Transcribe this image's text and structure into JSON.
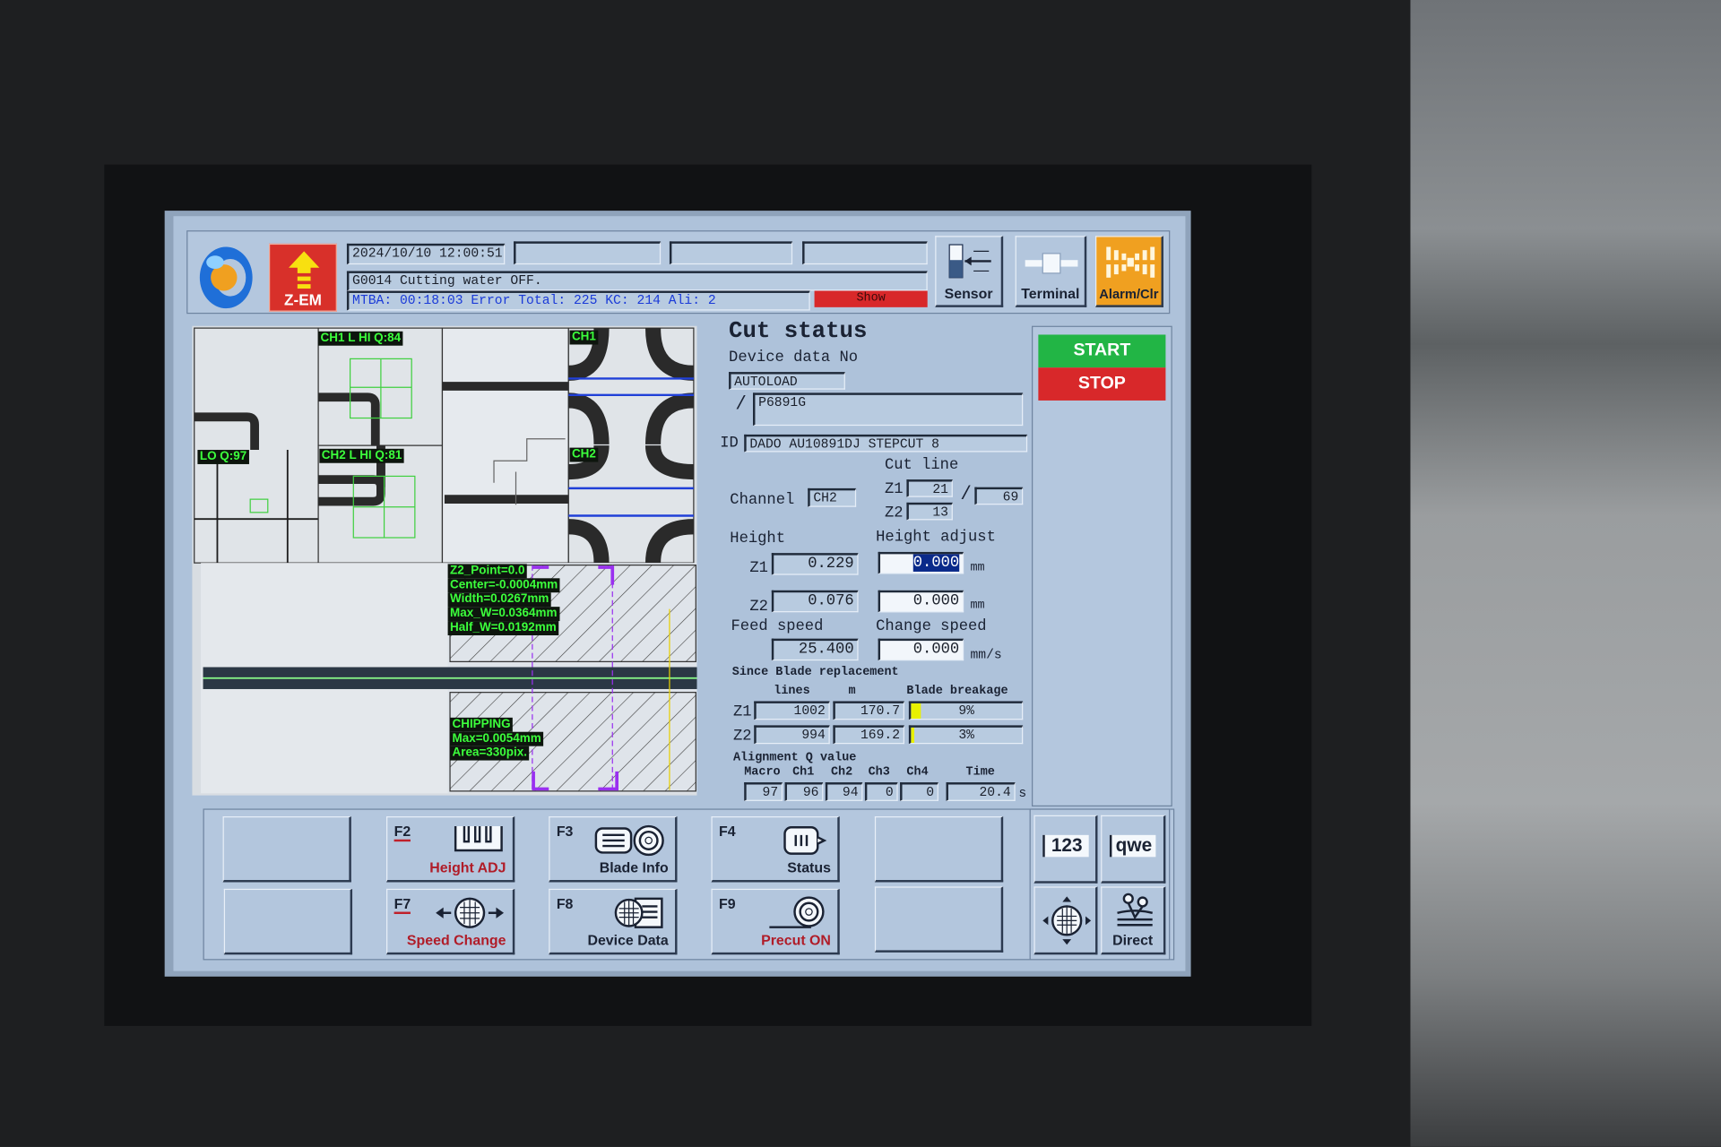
{
  "header": {
    "datetime": "2024/10/10 12:00:51",
    "message": "G0014  Cutting water OFF.",
    "stats": "MTBA: 00:18:03 Error Total: 225 KC: 214 Ali: 2",
    "show_label": "Show",
    "zem_label": "Z-EM",
    "sensor_label": "Sensor",
    "terminal_label": "Terminal",
    "alarm_label": "Alarm/Clr"
  },
  "camera": {
    "ch1_label": "CH1 L HI Q:84",
    "ch2_label": "CH2 L HI Q:81",
    "lo_label": "LO Q:97",
    "ch1_tag": "CH1",
    "ch2_tag": "CH2",
    "kerf": [
      "Z2_Point=0.0",
      "Center=-0.0004mm",
      "Width=0.0267mm",
      "Max_W=0.0364mm",
      "Half_W=0.0192mm"
    ],
    "chipping": [
      "CHIPPING",
      "Max=0.0054mm",
      "Area=330pix."
    ]
  },
  "cut_status": {
    "title": "Cut status",
    "device_data_label": "Device data No",
    "device_data": "AUTOLOAD",
    "slash": "/",
    "device_name": "P6891G",
    "id_label": "ID",
    "id_value": "DADO AU10891DJ STEPCUT 8",
    "cut_line_label": "Cut line",
    "channel_label": "Channel",
    "channel": "CH2",
    "z1_label": "Z1",
    "z2_label": "Z2",
    "cut_line_z1": "21",
    "cut_line_z2": "13",
    "cut_line_total": "69",
    "height_label": "Height",
    "height_adjust_label": "Height adjust",
    "height_z1": "0.229",
    "height_z2": "0.076",
    "adjust_z1": "0.000",
    "adjust_z2": "0.000",
    "unit_mm": "mm",
    "feed_speed_label": "Feed speed",
    "change_speed_label": "Change speed",
    "feed_speed": "25.400",
    "change_speed": "0.000",
    "unit_mms": "mm/s",
    "blade_label": "Since Blade replacement",
    "col_lines": "lines",
    "col_m": "m",
    "col_breakage": "Blade breakage",
    "blade_rows": [
      {
        "z": "Z1",
        "lines": "1002",
        "m": "170.7",
        "breakage": "9%",
        "breakage_pct": 9
      },
      {
        "z": "Z2",
        "lines": "994",
        "m": "169.2",
        "breakage": "3%",
        "breakage_pct": 3
      }
    ],
    "align_label": "Alignment Q value",
    "align_headers": [
      "Macro",
      "Ch1",
      "Ch2",
      "Ch3",
      "Ch4",
      "Time"
    ],
    "align_values": [
      "97",
      "96",
      "94",
      "0",
      "0",
      "20.4"
    ],
    "unit_s": "s"
  },
  "controls": {
    "start": "START",
    "stop": "STOP"
  },
  "fkeys": [
    {
      "key": "F2",
      "name": "Height ADJ",
      "icon": "height-adj-icon"
    },
    {
      "key": "F3",
      "name": "Blade Info",
      "icon": "blade-info-icon"
    },
    {
      "key": "F4",
      "name": "Status",
      "icon": "status-icon"
    },
    {
      "key": "F7",
      "name": "Speed Change",
      "icon": "speed-change-icon"
    },
    {
      "key": "F8",
      "name": "Device Data",
      "icon": "device-data-icon"
    },
    {
      "key": "F9",
      "name": "Precut ON",
      "icon": "precut-icon"
    }
  ],
  "side_keys": {
    "numeric": "123",
    "alpha": "qwe",
    "direct": "Direct"
  },
  "colors": {
    "start": "#22b545",
    "stop": "#d8282a",
    "alarm": "#f0a020",
    "zem": "#d8302a",
    "overlay_text": "#3cff3c",
    "breakage_bar": "#e8f000"
  }
}
